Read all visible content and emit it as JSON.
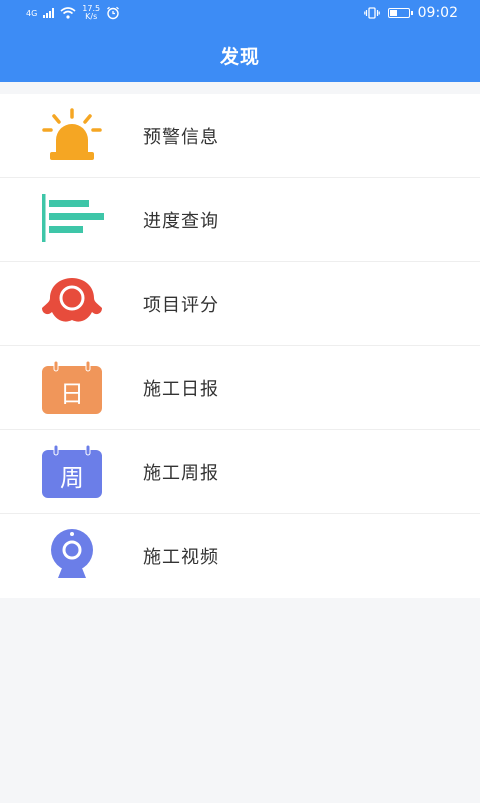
{
  "status_bar": {
    "network": "4G",
    "speed_value": "17.5",
    "speed_unit": "K/s",
    "time": "09:02",
    "battery_level": 0.35
  },
  "header": {
    "title": "发现"
  },
  "menu": {
    "items": [
      {
        "label": "预警信息",
        "icon": "alarm-light-icon",
        "color": "#f5a623"
      },
      {
        "label": "进度查询",
        "icon": "progress-bars-icon",
        "color": "#3ec6a8"
      },
      {
        "label": "项目评分",
        "icon": "badge-icon",
        "color": "#e74c3c"
      },
      {
        "label": "施工日报",
        "icon": "calendar-day-icon",
        "color": "#f0965a",
        "glyph": "日"
      },
      {
        "label": "施工周报",
        "icon": "calendar-week-icon",
        "color": "#6b7ee8",
        "glyph": "周"
      },
      {
        "label": "施工视频",
        "icon": "webcam-icon",
        "color": "#6b7ee8"
      }
    ]
  }
}
